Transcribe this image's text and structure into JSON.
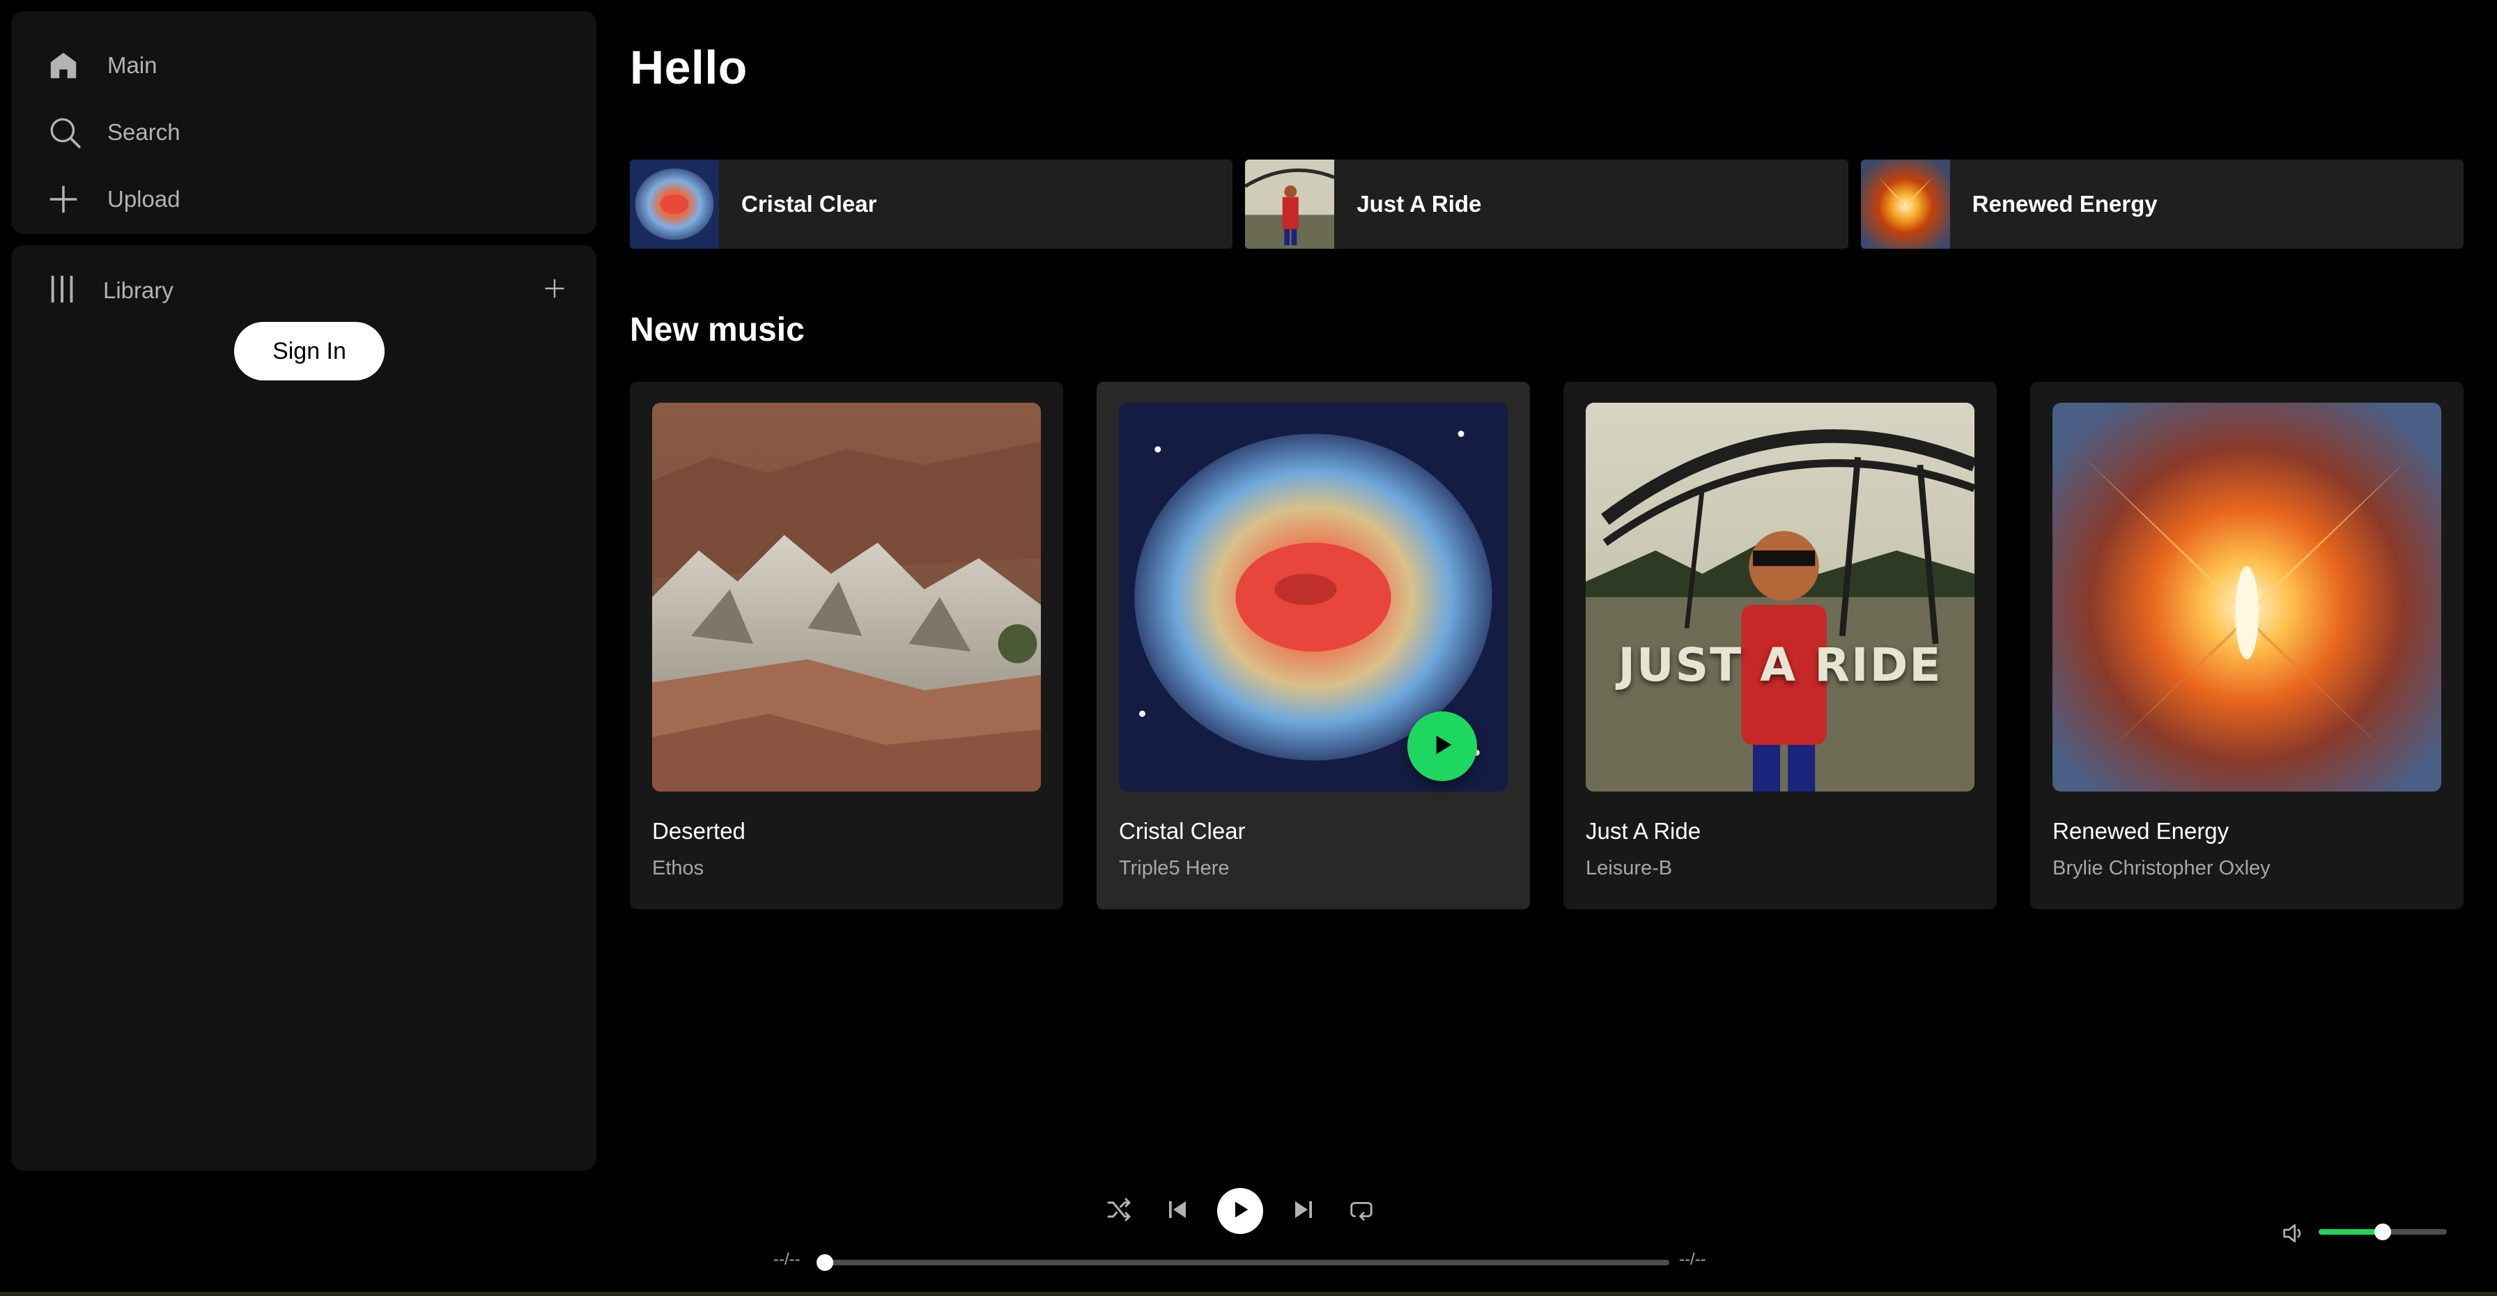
{
  "sidebar": {
    "nav": [
      {
        "label": "Main",
        "icon": "home-icon"
      },
      {
        "label": "Search",
        "icon": "search-icon"
      },
      {
        "label": "Upload",
        "icon": "plus-icon"
      }
    ],
    "library": {
      "label": "Library",
      "icon": "library-icon",
      "add_icon": "plus-icon"
    },
    "signin_label": "Sign In"
  },
  "main": {
    "greeting": "Hello",
    "quick_picks": [
      {
        "title": "Cristal Clear"
      },
      {
        "title": "Just A Ride"
      },
      {
        "title": "Renewed Energy"
      }
    ],
    "section_title": "New music",
    "cards": [
      {
        "title": "Deserted",
        "artist": "Ethos"
      },
      {
        "title": "Cristal Clear",
        "artist": "Triple5 Here"
      },
      {
        "title": "Just A Ride",
        "artist": "Leisure-B",
        "art_text": "JUST A RIDE"
      },
      {
        "title": "Renewed Energy",
        "artist": "Brylie Christopher Oxley"
      }
    ]
  },
  "player": {
    "time_elapsed": "--/--",
    "time_total": "--/--",
    "progress": 0.0,
    "volume": 0.5
  },
  "colors": {
    "accent": "#1ed760",
    "background": "#000000",
    "panel": "#121212",
    "card": "#181818",
    "card_hover": "#282828"
  }
}
